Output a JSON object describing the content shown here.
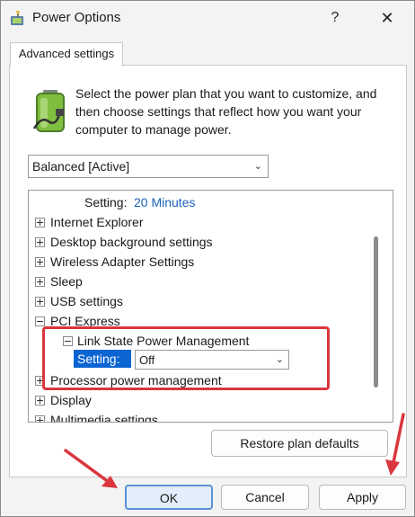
{
  "window": {
    "title": "Power Options",
    "help_glyph": "?",
    "close_glyph": "✕"
  },
  "tab": {
    "label": "Advanced settings"
  },
  "description": "Select the power plan that you want to customize, and then choose settings that reflect how you want your computer to manage power.",
  "plan_select": {
    "value": "Balanced [Active]"
  },
  "tree": {
    "top_setting": {
      "label": "Setting:",
      "value": "20 Minutes"
    },
    "items": [
      {
        "label": "Internet Explorer",
        "expander": "+"
      },
      {
        "label": "Desktop background settings",
        "expander": "+"
      },
      {
        "label": "Wireless Adapter Settings",
        "expander": "+"
      },
      {
        "label": "Sleep",
        "expander": "+"
      },
      {
        "label": "USB settings",
        "expander": "+"
      },
      {
        "label": "PCI Express",
        "expander": "-"
      },
      {
        "label": "Link State Power Management",
        "expander": "-"
      },
      {
        "label": "Processor power management",
        "expander": "+"
      },
      {
        "label": "Display",
        "expander": "+"
      },
      {
        "label": "Multimedia settings",
        "expander": "+"
      }
    ],
    "selected_setting": {
      "label": "Setting:",
      "value": "Off"
    }
  },
  "buttons": {
    "restore": "Restore plan defaults",
    "ok": "OK",
    "cancel": "Cancel",
    "apply": "Apply"
  },
  "colors": {
    "highlight_red": "#d9363e",
    "selection_blue": "#0a64d2",
    "link_blue": "#1a62b8"
  }
}
